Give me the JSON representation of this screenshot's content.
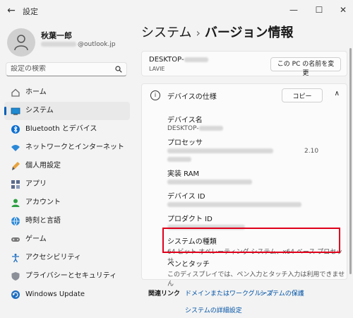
{
  "window": {
    "title": "設定",
    "back_icon": "←",
    "min_icon": "—",
    "max_icon": "☐",
    "close_icon": "✕"
  },
  "user": {
    "name": "秋葉一郎",
    "email_domain": "@outlook.jp"
  },
  "search": {
    "placeholder": "設定の検索"
  },
  "nav": {
    "items": [
      {
        "label": "ホーム",
        "icon": "home-icon"
      },
      {
        "label": "システム",
        "icon": "monitor-icon",
        "active": true
      },
      {
        "label": "Bluetooth とデバイス",
        "icon": "bluetooth-icon"
      },
      {
        "label": "ネットワークとインターネット",
        "icon": "wifi-icon"
      },
      {
        "label": "個人用設定",
        "icon": "brush-icon"
      },
      {
        "label": "アプリ",
        "icon": "apps-icon"
      },
      {
        "label": "アカウント",
        "icon": "account-icon"
      },
      {
        "label": "時刻と言語",
        "icon": "globe-icon"
      },
      {
        "label": "ゲーム",
        "icon": "gamepad-icon"
      },
      {
        "label": "アクセシビリティ",
        "icon": "accessibility-icon"
      },
      {
        "label": "プライバシーとセキュリティ",
        "icon": "shield-icon"
      },
      {
        "label": "Windows Update",
        "icon": "update-icon"
      }
    ]
  },
  "breadcrumb": {
    "parent": "システム",
    "separator": "›",
    "current": "バージョン情報"
  },
  "device": {
    "name_prefix": "DESKTOP-",
    "maker": "LAVIE",
    "rename_button": "この PC の名前を変更"
  },
  "spec": {
    "title": "デバイスの仕様",
    "copy_button": "コピー",
    "collapse_icon": "∧",
    "labels": {
      "device_name": "デバイス名",
      "processor": "プロセッサ",
      "ram": "実装 RAM",
      "device_id": "デバイス ID",
      "product_id": "プロダクト ID",
      "system_type": "システムの種類",
      "pen_touch": "ペンとタッチ"
    },
    "values": {
      "device_name_prefix": "DESKTOP-",
      "processor_speed": "2.10",
      "system_type": "64 ビット オペレーティング システム、x64 ベース プロセッサ",
      "pen_touch": "このディスプレイでは、ペン入力とタッチ入力は利用できません"
    }
  },
  "related": {
    "title": "関連リンク",
    "links": [
      "ドメインまたはワークグループ",
      "システムの保護",
      "システムの詳細設定"
    ]
  },
  "colors": {
    "accent": "#005fb8",
    "highlight_border": "#e0001b"
  }
}
